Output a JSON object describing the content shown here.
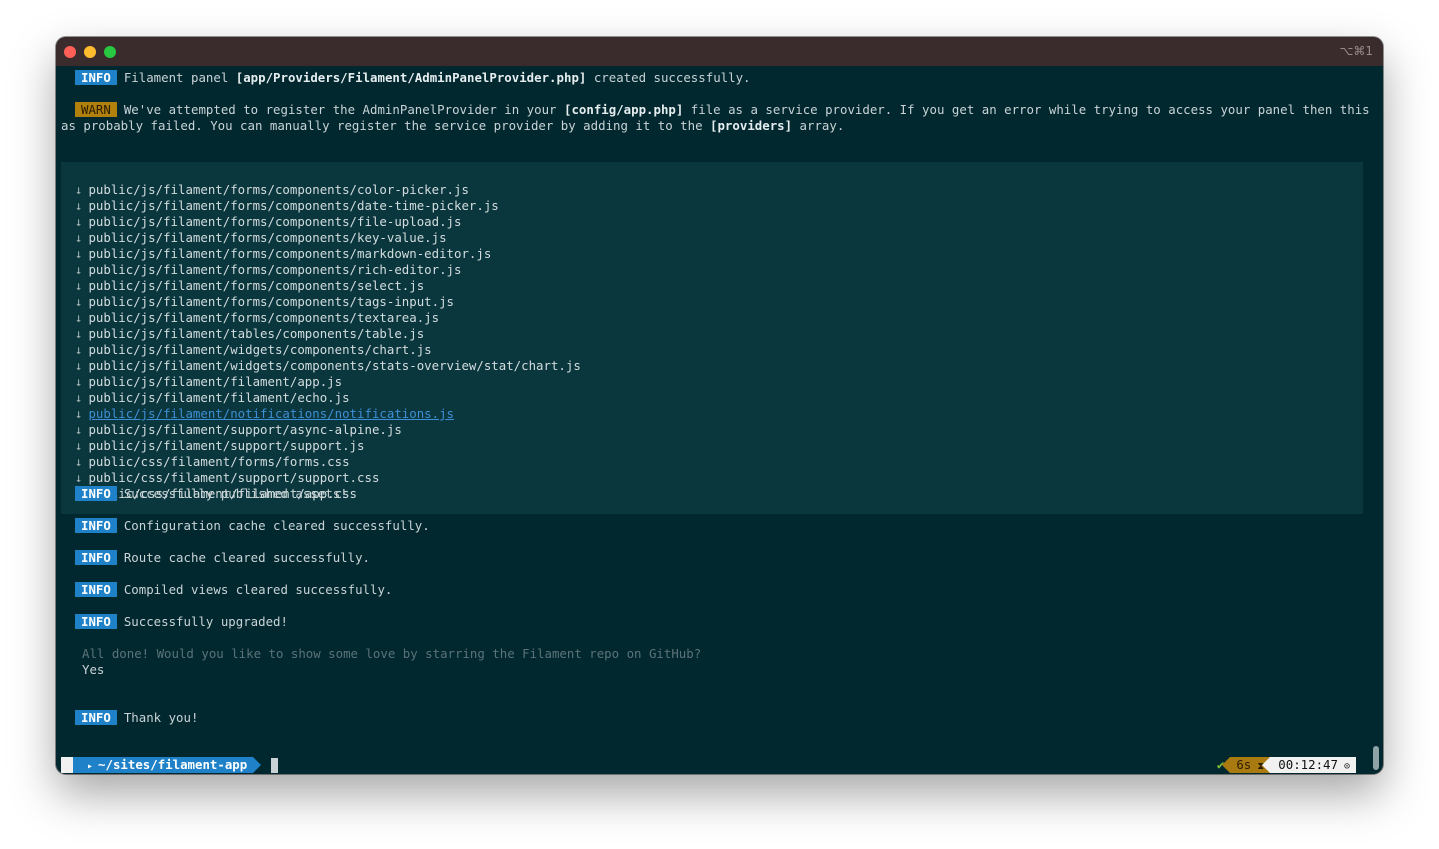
{
  "window": {
    "shortcut": "⌥⌘1"
  },
  "badges": {
    "info": "INFO",
    "warn": "WARN"
  },
  "messages": {
    "panel_created": {
      "pre": "Filament panel ",
      "path": "[app/Providers/Filament/AdminPanelProvider.php]",
      "post": " created successfully."
    },
    "warn": {
      "l1_pre": "We've attempted to register the AdminPanelProvider in your ",
      "l1_path": "[config/app.php]",
      "l1_post": " file as a service provider. If you get an error while trying to access your panel then this process h",
      "l2_pre": "as probably failed. You can manually register the service provider by adding it to the ",
      "l2_path": "[providers]",
      "l2_post": " array."
    },
    "published": "Successfully published assets!",
    "config_cache": "Configuration cache cleared successfully.",
    "route_cache": "Route cache cleared successfully.",
    "views": "Compiled views cleared successfully.",
    "upgraded": "Successfully upgraded!",
    "question": "All done! Would you like to show some love by starring the Filament repo on GitHub?",
    "answer": "Yes",
    "thanks": "Thank you!"
  },
  "files": [
    "public/js/filament/forms/components/color-picker.js",
    "public/js/filament/forms/components/date-time-picker.js",
    "public/js/filament/forms/components/file-upload.js",
    "public/js/filament/forms/components/key-value.js",
    "public/js/filament/forms/components/markdown-editor.js",
    "public/js/filament/forms/components/rich-editor.js",
    "public/js/filament/forms/components/select.js",
    "public/js/filament/forms/components/tags-input.js",
    "public/js/filament/forms/components/textarea.js",
    "public/js/filament/tables/components/table.js",
    "public/js/filament/widgets/components/chart.js",
    "public/js/filament/widgets/components/stats-overview/stat/chart.js",
    "public/js/filament/filament/app.js",
    "public/js/filament/filament/echo.js",
    "public/js/filament/notifications/notifications.js",
    "public/js/filament/support/async-alpine.js",
    "public/js/filament/support/support.js",
    "public/css/filament/forms/forms.css",
    "public/css/filament/support/support.css",
    "public/css/filament/filament/app.css"
  ],
  "file_arrow": "↓",
  "prompt": {
    "apple_icon": "",
    "folder_icon": "▸",
    "dir": "~/sites/filament-app",
    "status_icon": "✔",
    "duration": "6s",
    "duration_icon": "⧗",
    "time": "00:12:47",
    "clock_icon": "⊙"
  }
}
